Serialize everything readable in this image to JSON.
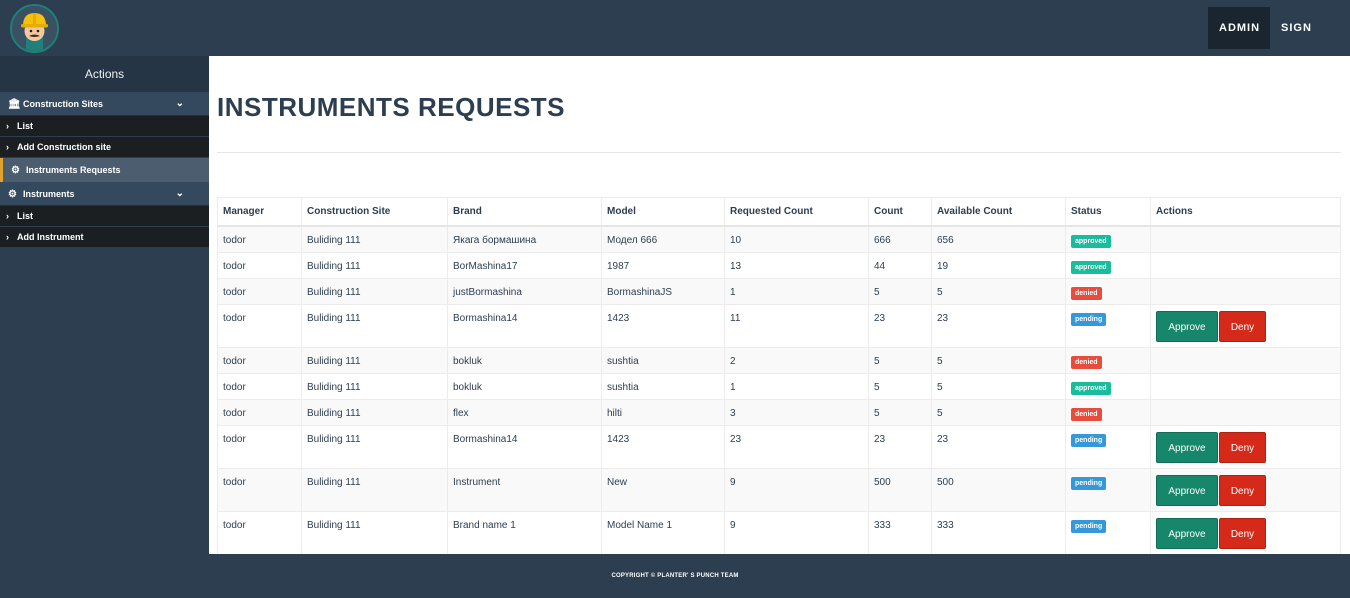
{
  "topbar": {
    "admin_label": "ADMIN",
    "signout_label": "SIGN OUT"
  },
  "sidebar": {
    "title": "Actions",
    "groups": [
      {
        "label": "Construction Sites",
        "icon": "bank-icon",
        "items": [
          {
            "label": "List"
          },
          {
            "label": "Add Construction site"
          }
        ]
      },
      {
        "label": "Instruments Requests",
        "icon": "gears-icon",
        "active": true
      },
      {
        "label": "Instruments",
        "icon": "gears-icon",
        "items": [
          {
            "label": "List"
          },
          {
            "label": "Add Instrument"
          }
        ]
      }
    ]
  },
  "main": {
    "title": "INSTRUMENTS REQUESTS",
    "table": {
      "headers": [
        "Manager",
        "Construction Site",
        "Brand",
        "Model",
        "Requested Count",
        "Count",
        "Available Count",
        "Status",
        "Actions"
      ],
      "rows": [
        {
          "manager": "todor",
          "site": "Buliding 111",
          "brand": "Якага бормашина",
          "model": "Модел 666",
          "requested": "10",
          "count": "666",
          "available": "656",
          "status": "approved"
        },
        {
          "manager": "todor",
          "site": "Buliding 111",
          "brand": "BorMashina17",
          "model": "1987",
          "requested": "13",
          "count": "44",
          "available": "19",
          "status": "approved"
        },
        {
          "manager": "todor",
          "site": "Buliding 111",
          "brand": "justBormashina",
          "model": "BormashinaJS",
          "requested": "1",
          "count": "5",
          "available": "5",
          "status": "denied"
        },
        {
          "manager": "todor",
          "site": "Buliding 111",
          "brand": "Bormashina14",
          "model": "1423",
          "requested": "11",
          "count": "23",
          "available": "23",
          "status": "pending"
        },
        {
          "manager": "todor",
          "site": "Buliding 111",
          "brand": "bokluk",
          "model": "sushtia",
          "requested": "2",
          "count": "5",
          "available": "5",
          "status": "denied"
        },
        {
          "manager": "todor",
          "site": "Buliding 111",
          "brand": "bokluk",
          "model": "sushtia",
          "requested": "1",
          "count": "5",
          "available": "5",
          "status": "approved"
        },
        {
          "manager": "todor",
          "site": "Buliding 111",
          "brand": "flex",
          "model": "hilti",
          "requested": "3",
          "count": "5",
          "available": "5",
          "status": "denied"
        },
        {
          "manager": "todor",
          "site": "Buliding 111",
          "brand": "Bormashina14",
          "model": "1423",
          "requested": "23",
          "count": "23",
          "available": "23",
          "status": "pending"
        },
        {
          "manager": "todor",
          "site": "Buliding 111",
          "brand": "Instrument",
          "model": "New",
          "requested": "9",
          "count": "500",
          "available": "500",
          "status": "pending"
        },
        {
          "manager": "todor",
          "site": "Buliding 111",
          "brand": "Brand name 1",
          "model": "Model Name 1",
          "requested": "9",
          "count": "333",
          "available": "333",
          "status": "pending"
        }
      ],
      "approve_label": "Approve",
      "deny_label": "Deny"
    }
  },
  "footer": {
    "text": "COPYRIGHT © PLANTER' S PUNCH TEAM"
  },
  "colors": {
    "navy": "#2c3e50",
    "approved": "#1abc9c",
    "denied": "#e74c3c",
    "pending": "#3498db",
    "approve_button": "#16876b",
    "deny_button": "#d52a1a"
  }
}
